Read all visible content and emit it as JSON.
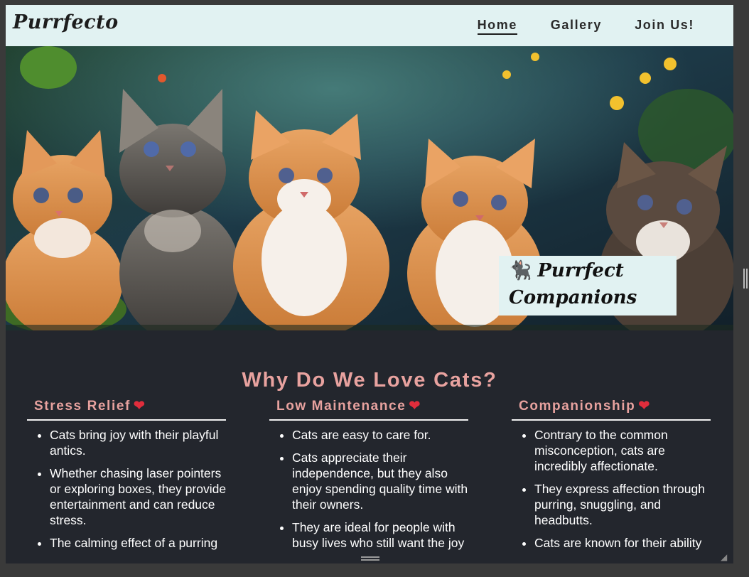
{
  "header": {
    "logo": "Purrfecto",
    "nav": [
      {
        "label": "Home",
        "active": true
      },
      {
        "label": "Gallery",
        "active": false
      },
      {
        "label": "Join Us!",
        "active": false
      }
    ]
  },
  "hero": {
    "card_line1": "Purrfect",
    "card_line2": "Companions",
    "card_icon": "cat-icon"
  },
  "main": {
    "title": "Why Do We Love Cats?",
    "heart_icon": "heart-icon",
    "columns": [
      {
        "heading": "Stress Relief",
        "items": [
          "Cats bring joy with their playful antics.",
          "Whether chasing laser pointers or exploring boxes, they provide entertainment and can reduce stress.",
          "The calming effect of a purring"
        ]
      },
      {
        "heading": "Low Maintenance",
        "items": [
          "Cats are easy to care for.",
          "Cats appreciate their independence, but they also enjoy spending quality time with their owners.",
          "They are ideal for people with busy lives who still want the joy"
        ]
      },
      {
        "heading": "Companionship",
        "items": [
          "Contrary to the common misconception, cats are incredibly affectionate.",
          "They express affection through purring, snuggling, and headbutts.",
          "Cats are known for their ability"
        ]
      }
    ]
  },
  "colors": {
    "header_bg": "#e1f2f2",
    "page_bg": "#23262d",
    "accent": "#e8a29f",
    "heart": "#e02d3c"
  }
}
